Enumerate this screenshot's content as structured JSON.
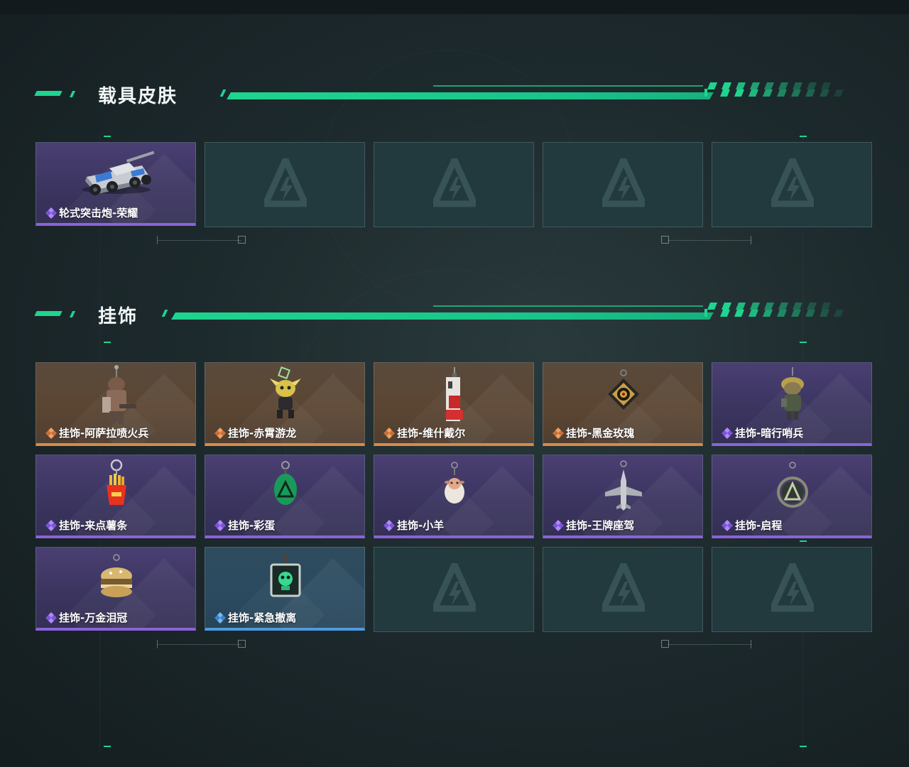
{
  "sections": [
    {
      "title": "载具皮肤",
      "items": [
        {
          "label": "轮式突击炮-荣耀",
          "rarity": "purple",
          "icon": "armored-vehicle-icon"
        },
        {
          "empty": true
        },
        {
          "empty": true
        },
        {
          "empty": true
        },
        {
          "empty": true
        }
      ]
    },
    {
      "title": "挂饰",
      "items": [
        {
          "label": "挂饰-阿萨拉喷火兵",
          "rarity": "orange",
          "icon": "flamethrower-soldier-charm-icon"
        },
        {
          "label": "挂饰-赤霄游龙",
          "rarity": "orange",
          "icon": "dragon-charm-icon"
        },
        {
          "label": "挂饰-维什戴尔",
          "rarity": "orange",
          "icon": "card-charm-icon"
        },
        {
          "label": "挂饰-黑金玫瑰",
          "rarity": "orange",
          "icon": "rose-emblem-charm-icon"
        },
        {
          "label": "挂饰-暗行哨兵",
          "rarity": "purple",
          "icon": "sentinel-charm-icon"
        },
        {
          "label": "挂饰-来点薯条",
          "rarity": "purple",
          "icon": "fries-charm-icon"
        },
        {
          "label": "挂饰-彩蛋",
          "rarity": "purple",
          "icon": "egg-charm-icon"
        },
        {
          "label": "挂饰-小羊",
          "rarity": "purple",
          "icon": "lamb-charm-icon"
        },
        {
          "label": "挂饰-王牌座驾",
          "rarity": "purple",
          "icon": "jet-charm-icon"
        },
        {
          "label": "挂饰-启程",
          "rarity": "purple",
          "icon": "compass-ring-charm-icon"
        },
        {
          "label": "挂饰-万金泪冠",
          "rarity": "purple",
          "icon": "crown-burger-charm-icon"
        },
        {
          "label": "挂饰-紧急撤离",
          "rarity": "blue",
          "icon": "skull-box-charm-icon"
        },
        {
          "empty": true
        },
        {
          "empty": true
        },
        {
          "empty": true
        }
      ]
    }
  ],
  "colors": {
    "accent": "#1fd48f",
    "rarity_purple": "#8b63d8",
    "rarity_orange": "#d98a48",
    "rarity_blue": "#4e9be0"
  }
}
